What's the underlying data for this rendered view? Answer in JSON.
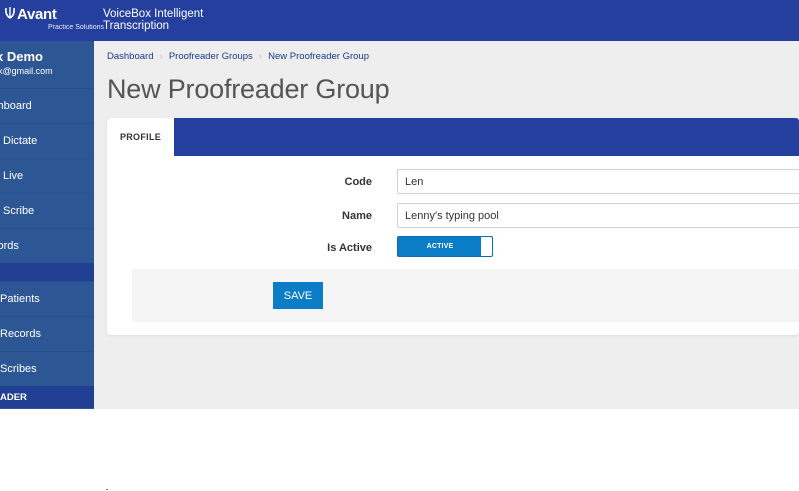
{
  "header": {
    "logo_text": "Avant",
    "logo_subtext": "Practice Solutions",
    "logo_icon": "avant-logo-icon",
    "app_title": "VoiceBox Intelligent Transcription"
  },
  "sidebar": {
    "user_name": "x Demo",
    "user_email": "x@gmail.com",
    "items": [
      {
        "label": "shboard"
      },
      {
        "label": "w Dictate"
      },
      {
        "label": "w Live"
      },
      {
        "label": "w Scribe"
      },
      {
        "label": "cords"
      },
      {
        "label": "Patients"
      },
      {
        "label": "Records"
      },
      {
        "label": "Scribes"
      }
    ],
    "section_header": "ADER"
  },
  "breadcrumb": {
    "items": [
      "Dashboard",
      "Proofreader Groups",
      "New Proofreader Group"
    ],
    "separator": "›"
  },
  "page": {
    "title": "New Proofreader Group"
  },
  "tabs": {
    "profile": "PROFILE"
  },
  "form": {
    "code_label": "Code",
    "code_value": "Len",
    "name_label": "Name",
    "name_value": "Lenny's typing pool",
    "active_label": "Is Active",
    "active_toggle_text": "ACTIVE",
    "active": true,
    "save_label": "SAVE"
  },
  "colors": {
    "header": "#243f9e",
    "sidebar": "#2d5695",
    "accent": "#0b7dc7"
  }
}
